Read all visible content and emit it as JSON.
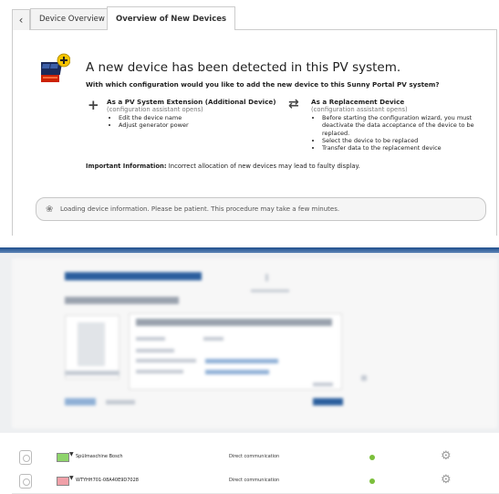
{
  "tabs": [
    {
      "label": "Device Overview"
    },
    {
      "label": "Overview of New Devices"
    }
  ],
  "notice": {
    "headline": "A new device has been detected in this PV system.",
    "question": "With which configuration would you like to add the new device to this Sunny Portal PV system?",
    "option_extension": {
      "title": "As a PV System Extension (Additional Device)",
      "subtitle": "(configuration assistant opens)",
      "items": [
        "Edit the device name",
        "Adjust generator power"
      ]
    },
    "option_replacement": {
      "title": "As a Replacement Device",
      "subtitle": "(configuration assistant opens)",
      "items": [
        "Before starting the configuration wizard, you must deactivate the data acceptance of the device to be replaced.",
        "Select the device to be replaced",
        "Transfer data to the replacement device"
      ]
    },
    "important_label": "Important Information:",
    "important_text": "Incorrect allocation of new devices may lead to faulty display."
  },
  "loading": {
    "text": "Loading device information. Please be patient. This procedure may take a few minutes."
  },
  "devices": [
    {
      "name": "Spülmaschine Bosch",
      "communication": "Direct communication",
      "swatch_color": "#8ed46b",
      "status_color": "#7bbf3b"
    },
    {
      "name": "WTYHH701-08A40E9D7028",
      "communication": "Direct communication",
      "swatch_color": "#f0a0a8",
      "status_color": "#7bbf3b"
    }
  ],
  "colors": {
    "accent_blue": "#1f4e8c",
    "status_ok": "#7bbf3b"
  }
}
